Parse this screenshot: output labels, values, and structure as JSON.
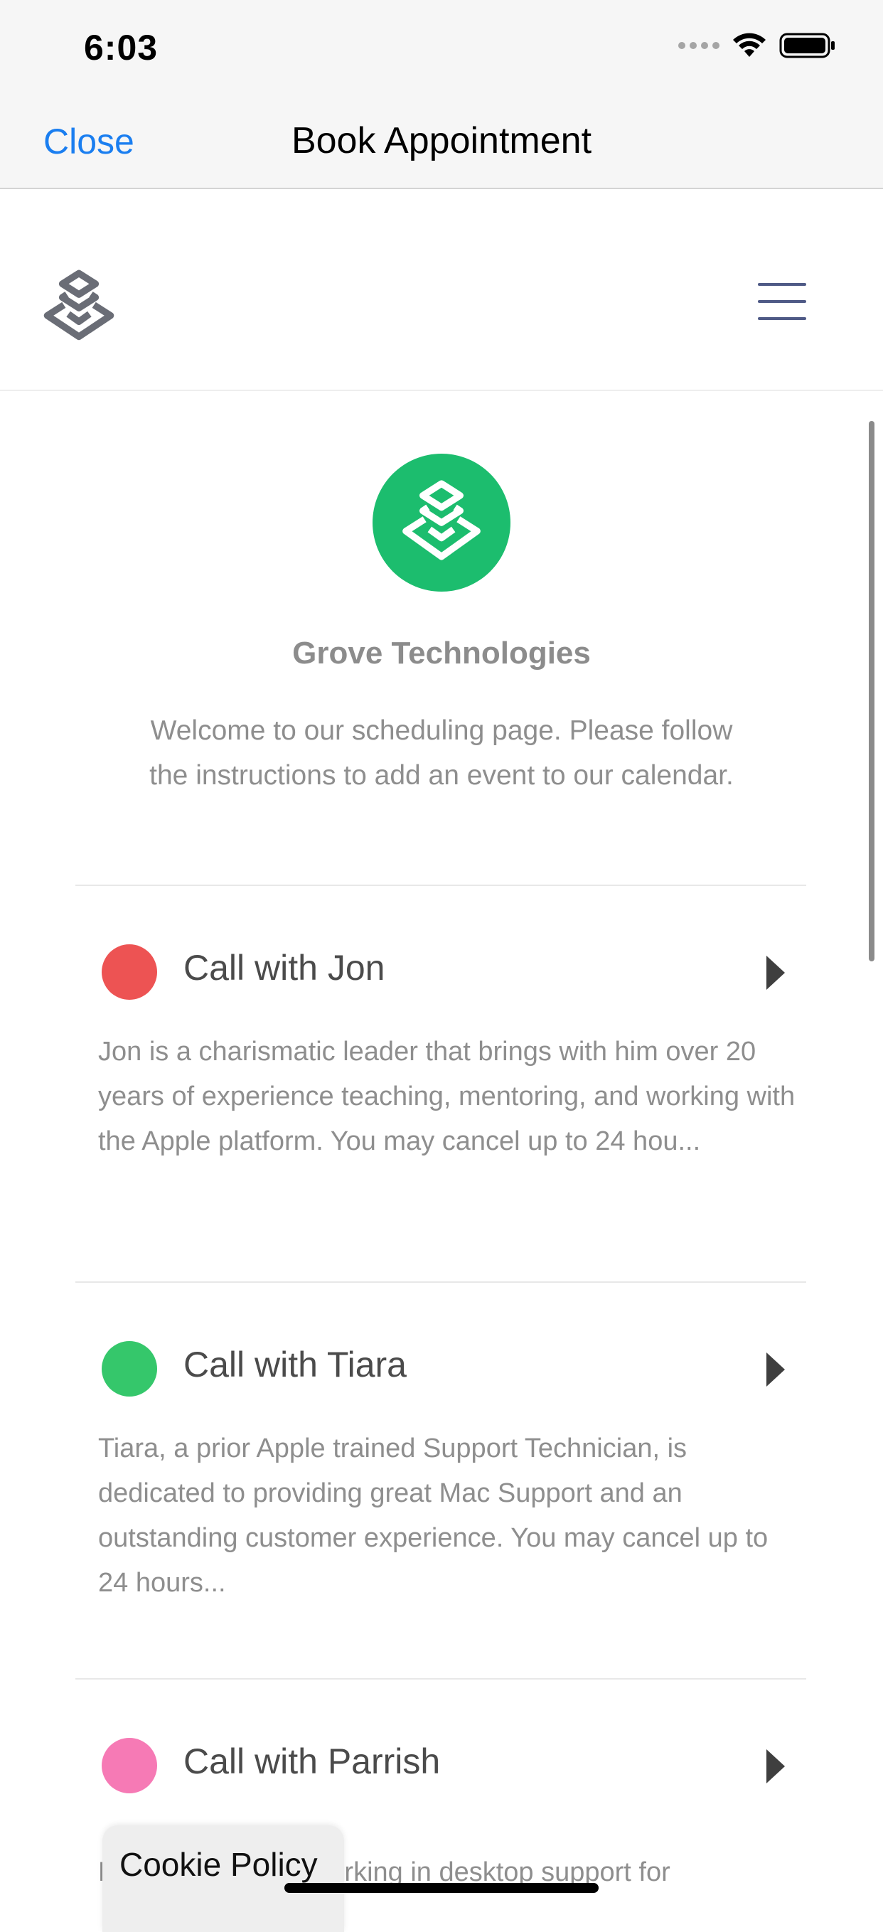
{
  "status_bar": {
    "time": "6:03"
  },
  "nav": {
    "close_label": "Close",
    "title": "Book Appointment"
  },
  "org": {
    "name": "Grove Technologies",
    "welcome": "Welcome to our scheduling page. Please follow the instructions to add an event to our calendar.",
    "brand_color": "#1cbd6e"
  },
  "events": [
    {
      "title": "Call with Jon",
      "color": "#ed5353",
      "description": "Jon is a charismatic leader that brings with him over 20 years of experience teaching, mentoring, and working with the Apple platform. You may cancel up to 24 hou..."
    },
    {
      "title": "Call with Tiara",
      "color": "#35c76b",
      "description": "Tiara, a prior Apple trained Support Technician, is dedicated to providing great Mac Support and an outstanding customer experience. You may cancel up to 24 hours..."
    },
    {
      "title": "Call with Parrish",
      "color": "#f67ab5",
      "description": "Parrish has been working in desktop support for"
    }
  ],
  "cookie": {
    "label": "Cookie Policy"
  },
  "colors": {
    "link": "#1a7ef0",
    "menu": "#4f5a86"
  }
}
